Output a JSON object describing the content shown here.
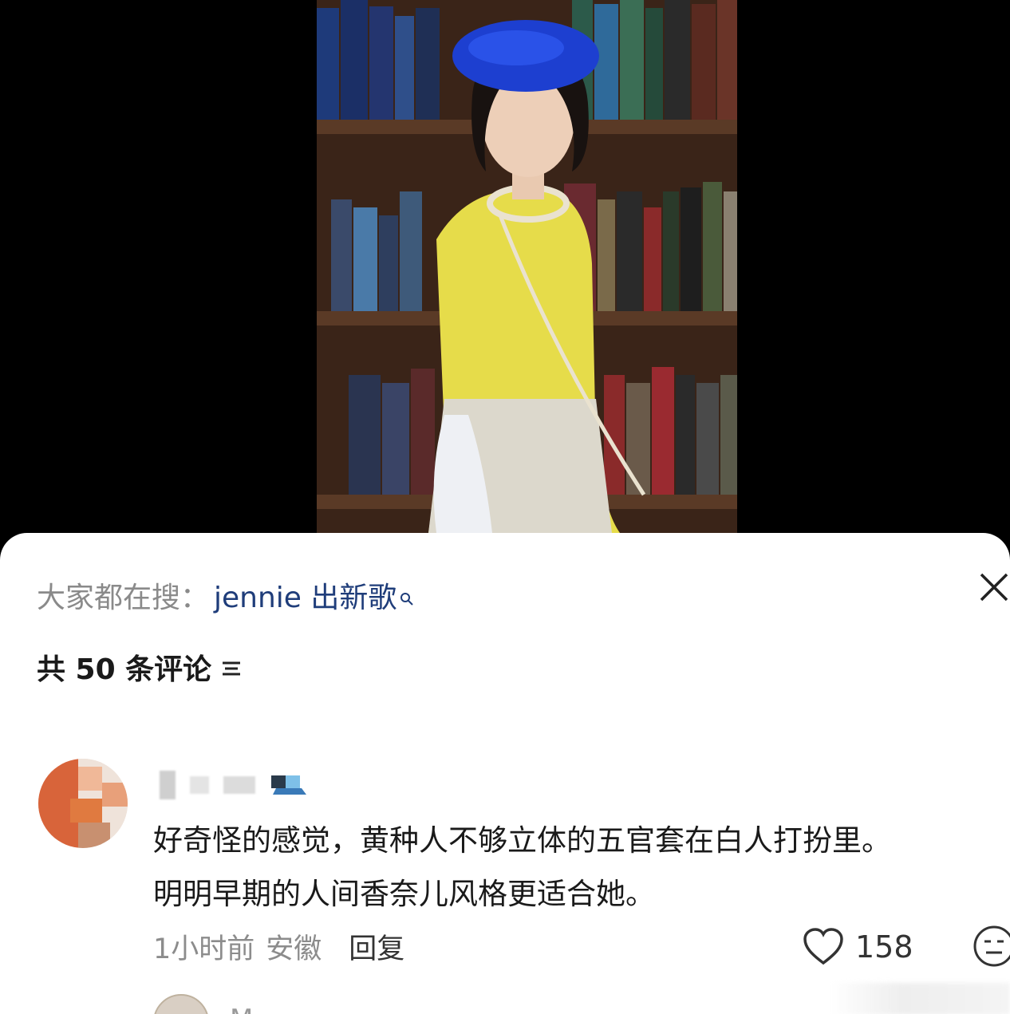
{
  "search": {
    "prefix": "大家都在搜：",
    "term": "jennie 出新歌"
  },
  "comments_header": {
    "count_label": "共 50 条评论"
  },
  "comment": {
    "line1": "好奇怪的感觉，黄种人不够立体的五官套在白人打扮里。",
    "line2": "明明早期的人间香奈儿风格更适合她。",
    "time": "1小时前",
    "location": "安徽",
    "reply_label": "回复",
    "like_count": "158"
  },
  "next_comment": {
    "name_partial": "M"
  },
  "icons": {
    "close": "close-icon",
    "sort": "sort-icon",
    "search_hint": "search-icon",
    "like": "heart-icon",
    "emoji": "emoji-face-icon"
  },
  "colors": {
    "search_term": "#1f3d7a",
    "muted_text": "#8a8a8a",
    "sheet_bg": "#ffffff",
    "hat_blue": "#1d3fd0",
    "dress_yellow": "#e6dc4a"
  }
}
